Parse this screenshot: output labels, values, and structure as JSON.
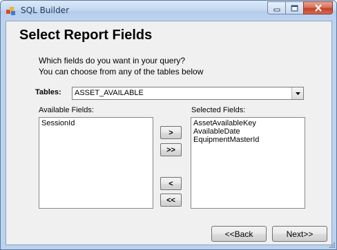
{
  "window": {
    "title": "SQL Builder",
    "icon": "sql-builder-app-icon",
    "controls": [
      "minimize-icon",
      "maximize-icon",
      "close-icon"
    ]
  },
  "page": {
    "heading": "Select Report Fields",
    "prompt_line1": "Which fields do you want in your query?",
    "prompt_line2": "You can choose from any of the tables below"
  },
  "tables": {
    "label": "Tables:",
    "selected": "ASSET_AVAILABLE"
  },
  "available": {
    "label": "Available Fields:",
    "items": [
      "SessionId"
    ]
  },
  "selected": {
    "label": "Selected Fields:",
    "items": [
      "AssetAvailableKey",
      "AvailableDate",
      "EquipmentMasterId"
    ]
  },
  "move_buttons": {
    "add_one": ">",
    "add_all": ">>",
    "remove_one": "<",
    "remove_all": "<<"
  },
  "nav": {
    "back": "<<Back",
    "next": "Next>>"
  }
}
